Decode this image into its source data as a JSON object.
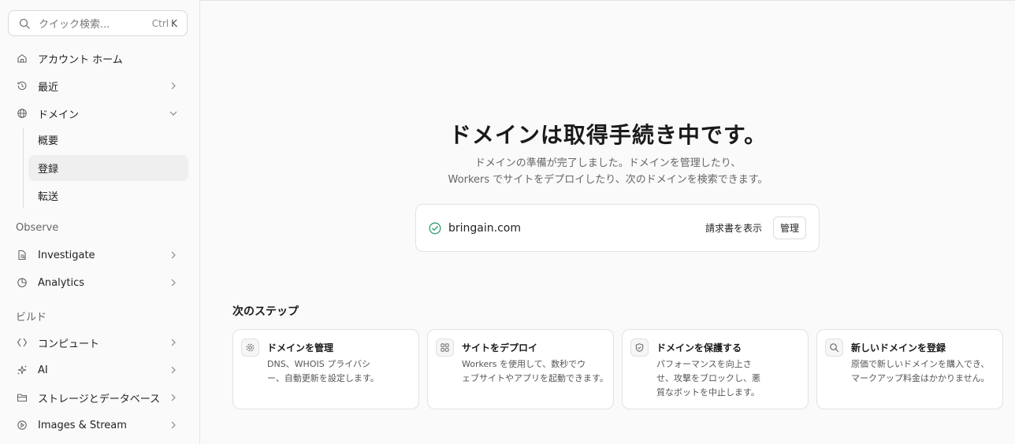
{
  "search": {
    "placeholder": "クイック検索...",
    "shortcut_mod": "Ctrl",
    "shortcut_key": "K"
  },
  "sidebar": {
    "account_home": "アカウント ホーム",
    "recent": "最近",
    "domains": "ドメイン",
    "domain_sub": [
      "概要",
      "登録",
      "転送"
    ],
    "observe_label": "Observe",
    "investigate": "Investigate",
    "analytics": "Analytics",
    "build_label": "ビルド",
    "compute": "コンピュート",
    "ai": "AI",
    "storage": "ストレージとデータベース",
    "images": "Images & Stream"
  },
  "hero": {
    "title": "ドメインは取得手続き中です。",
    "line1": "ドメインの準備が完了しました。ドメインを管理したり、",
    "line2": "Workers でサイトをデプロイしたり、次のドメインを検索できます。"
  },
  "domain_card": {
    "name": "bringain.com",
    "view_invoice": "請求書を表示",
    "manage": "管理"
  },
  "steps": {
    "title": "次のステップ",
    "cards": [
      {
        "title": "ドメインを管理",
        "l1": "DNS、WHOIS プライバシ",
        "l2": "ー、自動更新を設定します。",
        "l3": ""
      },
      {
        "title": "サイトをデプロイ",
        "l1": "Workers を使用して、数秒でウ",
        "l2": "ェブサイトやアプリを起動できます。",
        "l3": ""
      },
      {
        "title": "ドメインを保護する",
        "l1": "パフォーマンスを向上さ",
        "l2": "せ、攻撃をブロックし、悪",
        "l3": "質なボットを中止します。"
      },
      {
        "title": "新しいドメインを登録",
        "l1": "原価で新しいドメインを購入でき、",
        "l2": "マークアップ料金はかかりません。",
        "l3": ""
      }
    ]
  },
  "colors": {
    "success": "#2e9e6b",
    "border": "#e2e2e2",
    "active_bg": "#efefef"
  }
}
